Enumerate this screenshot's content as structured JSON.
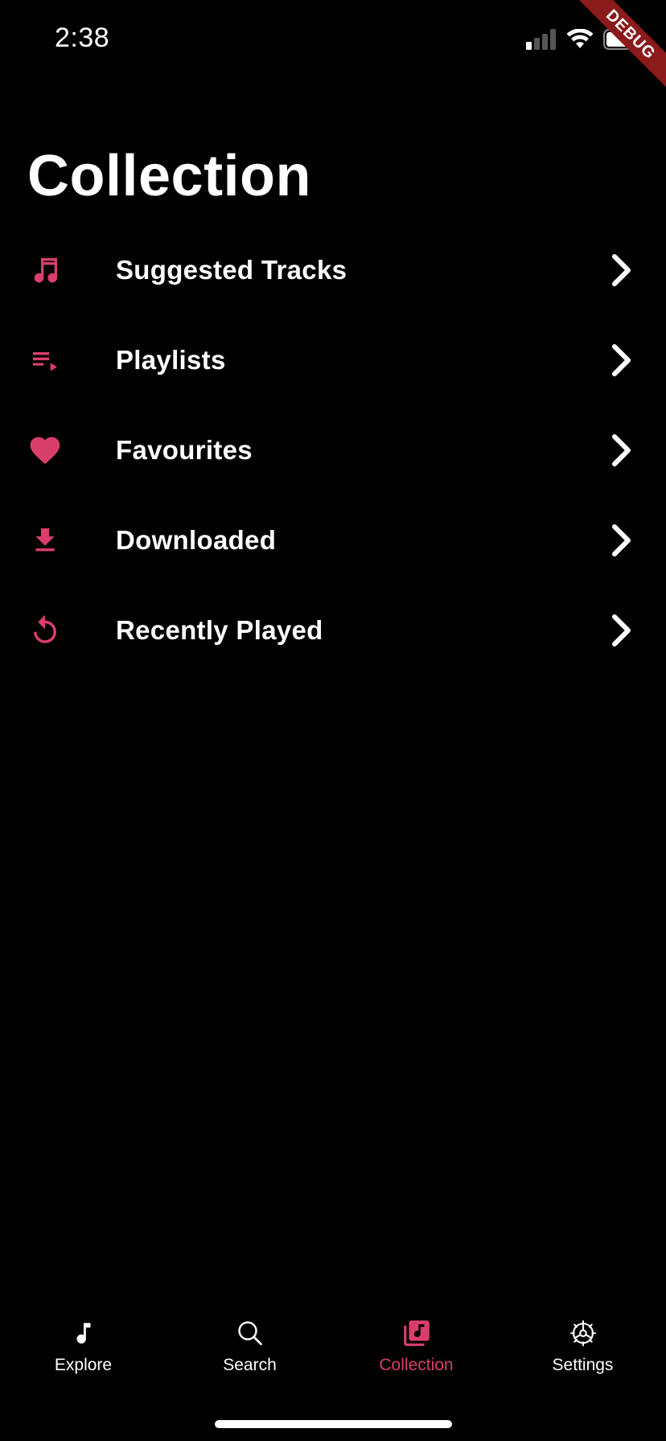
{
  "status_bar": {
    "time": "2:38",
    "signal_icon": "cellular-signal-icon",
    "wifi_icon": "wifi-icon",
    "battery_icon": "battery-icon",
    "debug_label": "DEBUG"
  },
  "page": {
    "title": "Collection"
  },
  "menu": {
    "items": [
      {
        "label": "Suggested Tracks",
        "icon": "music-note-icon"
      },
      {
        "label": "Playlists",
        "icon": "playlist-play-icon"
      },
      {
        "label": "Favourites",
        "icon": "heart-icon"
      },
      {
        "label": "Downloaded",
        "icon": "download-icon"
      },
      {
        "label": "Recently Played",
        "icon": "replay-icon"
      }
    ],
    "chevron_icon": "chevron-right-icon"
  },
  "tab_bar": {
    "tabs": [
      {
        "label": "Explore",
        "icon": "music-note-icon",
        "active": false
      },
      {
        "label": "Search",
        "icon": "search-icon",
        "active": false
      },
      {
        "label": "Collection",
        "icon": "music-library-icon",
        "active": true
      },
      {
        "label": "Settings",
        "icon": "gear-icon",
        "active": false
      }
    ]
  },
  "colors": {
    "background": "#000000",
    "accent": "#d93e6b",
    "text": "#ffffff",
    "debug_banner": "#8b1a1a"
  }
}
